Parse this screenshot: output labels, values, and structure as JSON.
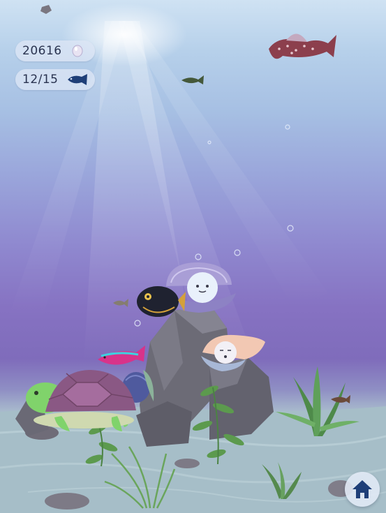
{
  "hud": {
    "coins": {
      "value": "20616",
      "icon": "pearl-icon"
    },
    "fish_count": {
      "value": "12/15",
      "icon": "fish-icon"
    }
  },
  "nav": {
    "home_icon": "home-icon"
  },
  "colors": {
    "water_top": "#cfe2f3",
    "water_mid": "#8f88cf",
    "sand": "#a9c3cd",
    "rock": "#6f6e78",
    "clam": "#9a90c9",
    "turtle_shell": "#8b5a86",
    "turtle_skin": "#7fd36b",
    "home_icon": "#1f3f78"
  }
}
